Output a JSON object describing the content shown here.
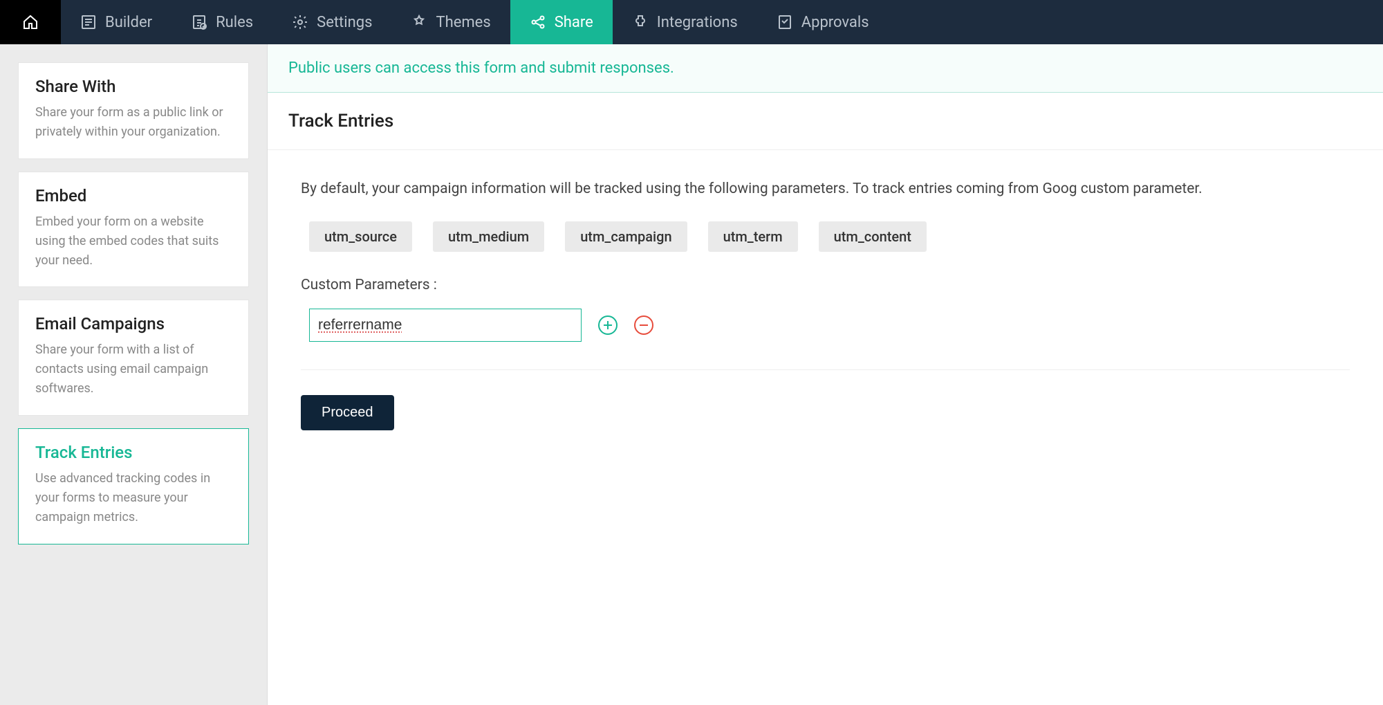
{
  "nav": {
    "items": [
      {
        "label": "Builder"
      },
      {
        "label": "Rules"
      },
      {
        "label": "Settings"
      },
      {
        "label": "Themes"
      },
      {
        "label": "Share"
      },
      {
        "label": "Integrations"
      },
      {
        "label": "Approvals"
      }
    ]
  },
  "sidebar": {
    "items": [
      {
        "title": "Share With",
        "desc": "Share your form as a public link or privately within your organization."
      },
      {
        "title": "Embed",
        "desc": "Embed your form on a website using the embed codes that suits your need."
      },
      {
        "title": "Email Campaigns",
        "desc": "Share your form with a list of contacts using email campaign softwares."
      },
      {
        "title": "Track Entries",
        "desc": "Use advanced tracking codes in your forms to measure your campaign metrics."
      }
    ]
  },
  "main": {
    "banner": "Public users can access this form and submit responses.",
    "title": "Track Entries",
    "intro": "By default, your campaign information will be tracked using the following parameters. To track entries coming from Goog custom parameter.",
    "tags": [
      "utm_source",
      "utm_medium",
      "utm_campaign",
      "utm_term",
      "utm_content"
    ],
    "custom_label": "Custom Parameters :",
    "custom_param_value": "referrername",
    "proceed_label": "Proceed"
  },
  "colors": {
    "accent": "#17b795",
    "navbar": "#1d2c3e",
    "danger": "#e74c3c"
  }
}
